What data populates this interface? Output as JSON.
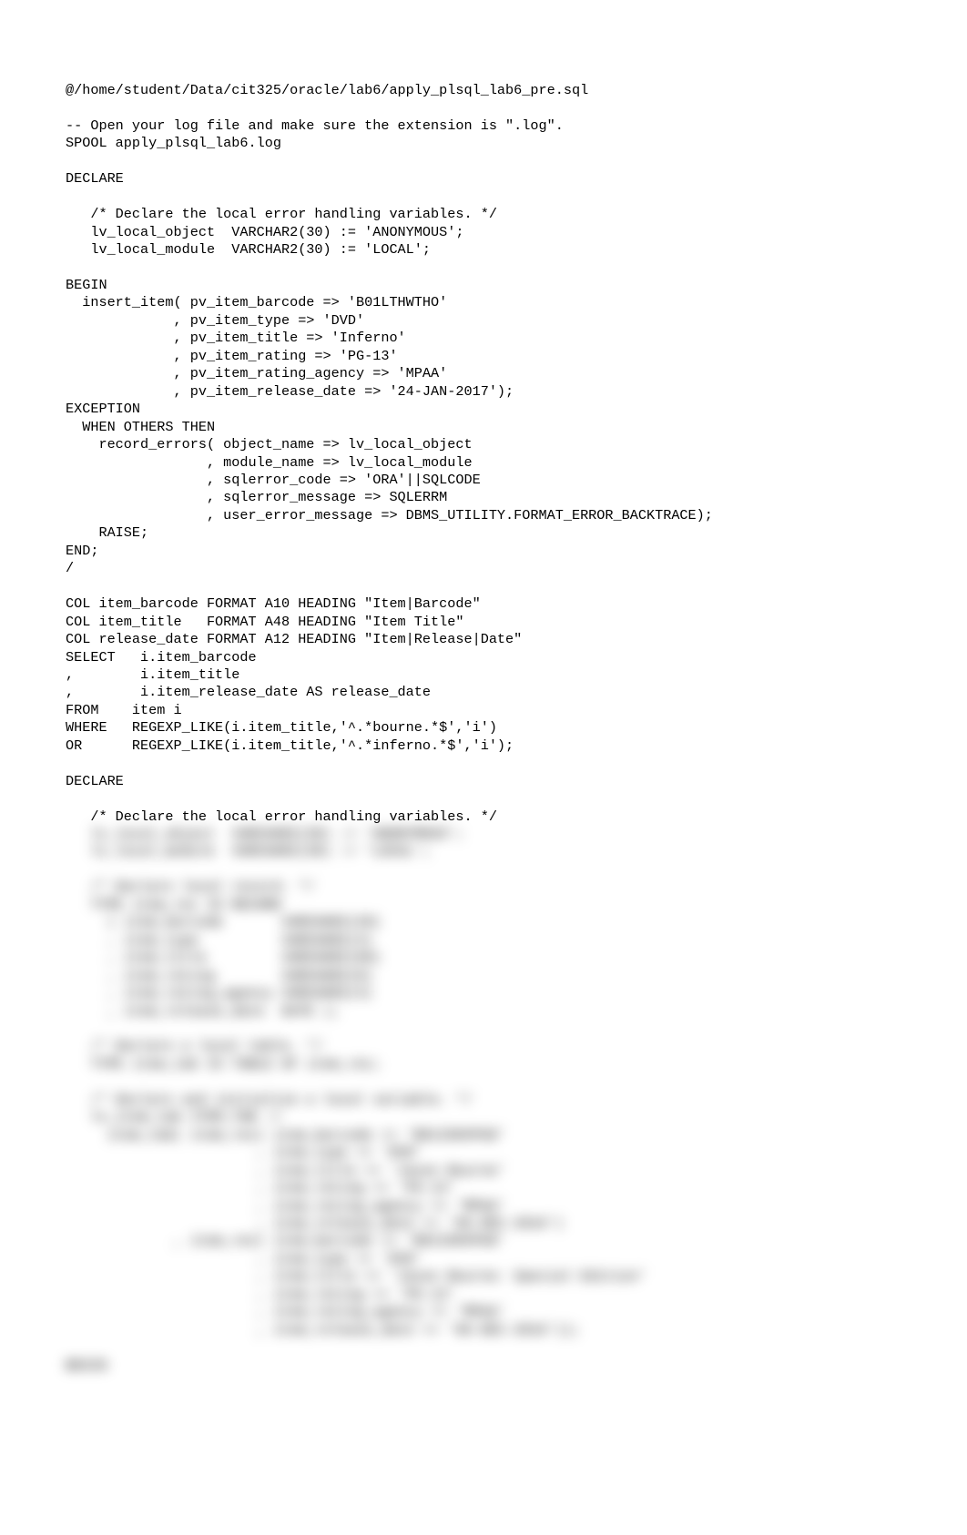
{
  "code": {
    "lines": [
      "@/home/student/Data/cit325/oracle/lab6/apply_plsql_lab6_pre.sql",
      "",
      "-- Open your log file and make sure the extension is \".log\".",
      "SPOOL apply_plsql_lab6.log",
      "",
      "DECLARE",
      "",
      "   /* Declare the local error handling variables. */",
      "   lv_local_object  VARCHAR2(30) := 'ANONYMOUS';",
      "   lv_local_module  VARCHAR2(30) := 'LOCAL';",
      "",
      "BEGIN",
      "  insert_item( pv_item_barcode => 'B01LTHWTHO'",
      "             , pv_item_type => 'DVD'",
      "             , pv_item_title => 'Inferno'",
      "             , pv_item_rating => 'PG-13'",
      "             , pv_item_rating_agency => 'MPAA'",
      "             , pv_item_release_date => '24-JAN-2017');",
      "EXCEPTION",
      "  WHEN OTHERS THEN",
      "    record_errors( object_name => lv_local_object",
      "                 , module_name => lv_local_module",
      "                 , sqlerror_code => 'ORA'||SQLCODE",
      "                 , sqlerror_message => SQLERRM",
      "                 , user_error_message => DBMS_UTILITY.FORMAT_ERROR_BACKTRACE);",
      "    RAISE;",
      "END;",
      "/",
      "",
      "COL item_barcode FORMAT A10 HEADING \"Item|Barcode\"",
      "COL item_title   FORMAT A48 HEADING \"Item Title\"",
      "COL release_date FORMAT A12 HEADING \"Item|Release|Date\"",
      "SELECT   i.item_barcode",
      ",        i.item_title",
      ",        i.item_release_date AS release_date",
      "FROM    item i",
      "WHERE   REGEXP_LIKE(i.item_title,'^.*bourne.*$','i')",
      "OR      REGEXP_LIKE(i.item_title,'^.*inferno.*$','i');",
      "",
      "DECLARE",
      "",
      "   /* Declare the local error handling variables. */"
    ]
  },
  "obscured": {
    "lines": [
      "   lv_local_object  VARCHAR2(30) := 'ANONYMOUS';",
      "   lv_local_module  VARCHAR2(30) := 'LOCAL';",
      "",
      "   /* Declare local record. */",
      "   TYPE item_rec IS RECORD",
      "     ( item_barcode       VARCHAR2(20)",
      "     , item_type          VARCHAR2(4)",
      "     , item_title         VARCHAR2(60)",
      "     , item_rating        VARCHAR2(8)",
      "     , item_rating_agency VARCHAR2(4)",
      "     , item_release_date  DATE );",
      "",
      "   /* Declare a local table. */",
      "   TYPE item_tab IS TABLE OF item_rec;",
      "",
      "   /* Declare and initialize a local variable. */",
      "   lv_item_tab ITEM_TAB :=",
      "     item_tab( item_rec( item_barcode => 'B01IOHVPA8'",
      "                       , item_type => 'DVD'",
      "                       , item_title => 'Jason Bourne'",
      "                       , item_rating => 'PG-13'",
      "                       , item_rating_agency => 'MPAA'",
      "                       , item_release_date => '06-DEC-2016')",
      "             , item_rec( item_barcode => 'B01IOHVPA8'",
      "                       , item_type => 'DVD'",
      "                       , item_title => 'Jason Bourne: Special Edition'",
      "                       , item_rating => 'PG-13'",
      "                       , item_rating_agency => 'MPAA'",
      "                       , item_release_date => '06-DEC-2016'));",
      "",
      "BEGIN"
    ]
  }
}
